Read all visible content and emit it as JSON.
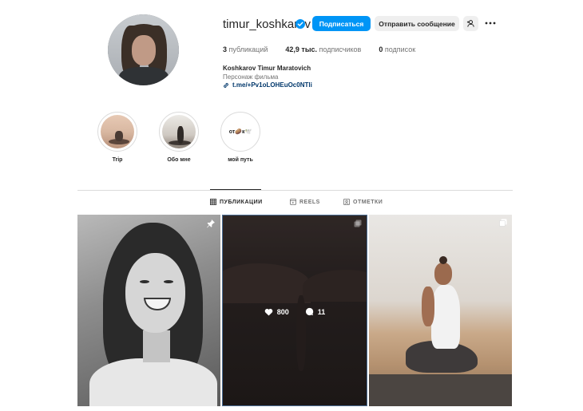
{
  "profile": {
    "username": "timur_koshkarov",
    "follow_label": "Подписаться",
    "message_label": "Отправить сообщение",
    "stats": {
      "posts_count": "3",
      "posts_label": "публикаций",
      "followers_count": "42,9 тыс.",
      "followers_label": "подписчиков",
      "following_count": "0",
      "following_label": "подписок"
    },
    "full_name": "Koshkarov Timur Maratovich",
    "category": "Персонаж фильма",
    "link": "t.me/+Pv1oLOHEuOc0NTli"
  },
  "highlights": [
    {
      "label": "Trip"
    },
    {
      "label": "Обо мне"
    },
    {
      "label": "мой путь",
      "cover_text": "от🥔к🕊️"
    }
  ],
  "tabs": {
    "posts": "ПУБЛИКАЦИИ",
    "reels": "REELS",
    "tagged": "ОТМЕТКИ"
  },
  "posts": [
    {
      "pinned": true
    },
    {
      "likes": "800",
      "comments": "11",
      "multi": true
    },
    {
      "multi": true
    }
  ],
  "colors": {
    "accent": "#0095f6",
    "link": "#00376b",
    "secondary_text": "#737373"
  }
}
